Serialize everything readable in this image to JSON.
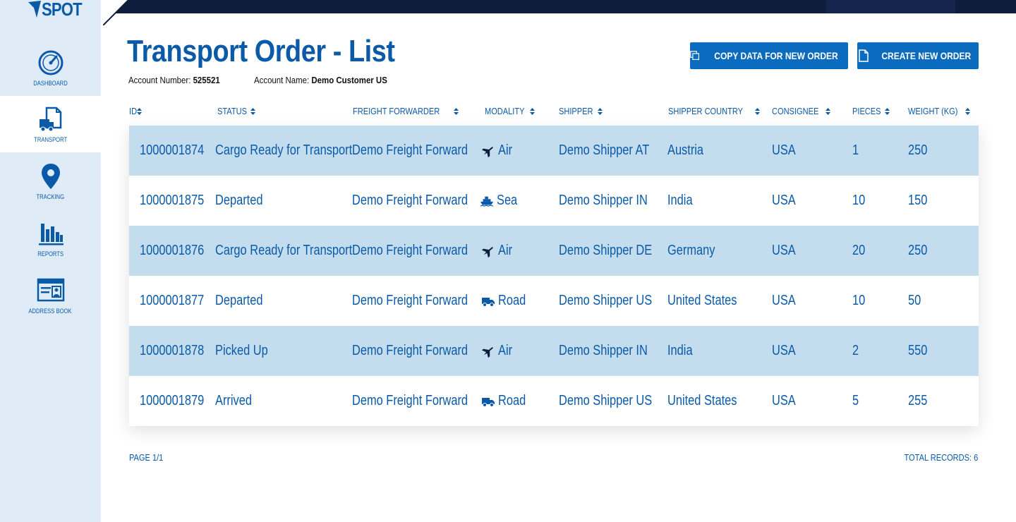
{
  "app": {
    "logo_text": "SPOT"
  },
  "sidebar": {
    "items": [
      {
        "label": "DASHBOARD",
        "icon": "speedometer-icon"
      },
      {
        "label": "TRANSPORT",
        "icon": "truck-document-icon",
        "active": true
      },
      {
        "label": "TRACKING",
        "icon": "map-pin-icon"
      },
      {
        "label": "REPORTS",
        "icon": "bar-chart-icon"
      },
      {
        "label": "ADDRESS BOOK",
        "icon": "contact-card-icon"
      }
    ]
  },
  "header": {
    "title": "Transport Order - List",
    "account_number_label": "Account Number:",
    "account_number": "525521",
    "account_name_label": "Account Name:",
    "account_name": "Demo Customer US",
    "copy_button": "COPY DATA FOR NEW ORDER",
    "create_button": "CREATE NEW ORDER"
  },
  "table": {
    "columns": [
      "ID",
      "STATUS",
      "FREIGHT FORWARDER",
      "MODALITY",
      "SHIPPER",
      "SHIPPER COUNTRY",
      "CONSIGNEE",
      "PIECES",
      "WEIGHT (KG)"
    ],
    "rows": [
      {
        "id": "1000001874",
        "status": "Cargo Ready for Transport",
        "forwarder": "Demo Freight Forward",
        "modality": "Air",
        "modality_icon": "airplane-icon",
        "shipper": "Demo Shipper AT",
        "country": "Austria",
        "consignee": "USA",
        "pieces": "1",
        "weight": "250"
      },
      {
        "id": "1000001875",
        "status": "Departed",
        "forwarder": "Demo Freight Forward",
        "modality": "Sea",
        "modality_icon": "ship-icon",
        "shipper": "Demo Shipper IN",
        "country": "India",
        "consignee": "USA",
        "pieces": "10",
        "weight": "150"
      },
      {
        "id": "1000001876",
        "status": "Cargo Ready for Transport",
        "forwarder": "Demo Freight Forward",
        "modality": "Air",
        "modality_icon": "airplane-icon",
        "shipper": "Demo Shipper DE",
        "country": "Germany",
        "consignee": "USA",
        "pieces": "20",
        "weight": "250"
      },
      {
        "id": "1000001877",
        "status": "Departed",
        "forwarder": "Demo Freight Forward",
        "modality": "Road",
        "modality_icon": "truck-icon",
        "shipper": "Demo Shipper US",
        "country": "United States",
        "consignee": "USA",
        "pieces": "10",
        "weight": "50"
      },
      {
        "id": "1000001878",
        "status": "Picked Up",
        "forwarder": "Demo Freight Forward",
        "modality": "Air",
        "modality_icon": "airplane-icon",
        "shipper": "Demo Shipper IN",
        "country": "India",
        "consignee": "USA",
        "pieces": "2",
        "weight": "550"
      },
      {
        "id": "1000001879",
        "status": "Arrived",
        "forwarder": "Demo Freight Forward",
        "modality": "Road",
        "modality_icon": "truck-icon",
        "shipper": "Demo Shipper US",
        "country": "United States",
        "consignee": "USA",
        "pieces": "5",
        "weight": "255"
      }
    ]
  },
  "footer": {
    "page": "PAGE 1/1",
    "total": "TOTAL RECORDS: 6"
  },
  "colors": {
    "primary": "#0a5aa8",
    "button": "#0a6bbf",
    "sidebar_bg": "#dfecf7",
    "row_highlight": "#c3ddef",
    "topbar": "#0f1d3d"
  }
}
